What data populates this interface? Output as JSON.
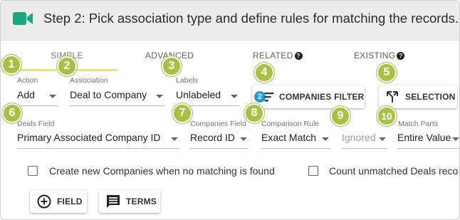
{
  "header": {
    "title": "Step 2: Pick association type and define rules for matching the records.",
    "icon": "video-camera-icon",
    "icon_color": "#1aa77e"
  },
  "tabs": {
    "simple": "SIMPLE",
    "advanced": "ADVANCED",
    "related": "RELATED",
    "existing": "EXISTING",
    "active_underline_color": "#f4df7a"
  },
  "badges": [
    "1",
    "2",
    "3",
    "4",
    "5",
    "6",
    "7",
    "8",
    "9",
    "10"
  ],
  "badge_color": "#a7c142",
  "row1": {
    "action_label": "Action",
    "action_value": "Add",
    "association_label": "Association",
    "association_value": "Deal to Company",
    "labels_label": "Labels",
    "labels_value": "Unlabeled",
    "companies_filter_count": "2",
    "companies_filter_label": "COMPANIES FILTER",
    "selection_label": "SELECTION"
  },
  "row2": {
    "deals_field_label": "Deals Field",
    "deals_field_value": "Primary Associated Company ID",
    "companies_field_label": "Companies Field",
    "companies_field_value": "Record ID",
    "comparison_rule_label": "Comparison Rule",
    "comparison_rule_value": "Exact Match",
    "ignored_value": "Ignored",
    "match_parts_label": "Match Parts",
    "match_parts_value": "Entire Value"
  },
  "options": {
    "create_new": "Create new Companies when no matching is found",
    "count_unmatched": "Count unmatched Deals reco"
  },
  "actions": {
    "field_label": "FIELD",
    "terms_label": "TERMS"
  }
}
